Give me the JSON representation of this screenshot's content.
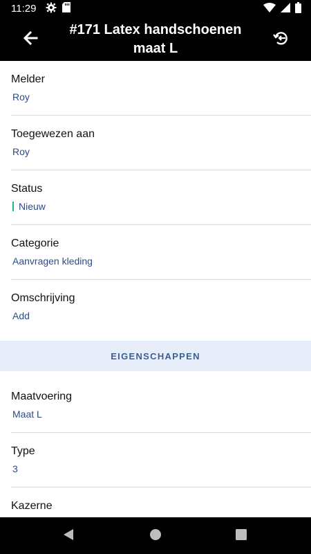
{
  "status_bar": {
    "time": "11:29",
    "left_icons": [
      "gear-icon",
      "sd-card-icon"
    ],
    "right_icons": [
      "wifi-icon",
      "signal-icon",
      "battery-icon"
    ]
  },
  "app_bar": {
    "title": "#171 Latex handschoenen maat L",
    "back_icon": "arrow-left-icon",
    "history_icon": "history-icon"
  },
  "fields": [
    {
      "label": "Melder",
      "value": "Roy"
    },
    {
      "label": "Toegewezen aan",
      "value": "Roy"
    },
    {
      "label": "Status",
      "value": "Nieuw",
      "status_color": "#18b78a"
    },
    {
      "label": "Categorie",
      "value": "Aanvragen kleding"
    },
    {
      "label": "Omschrijving",
      "value": "Add"
    }
  ],
  "section": {
    "title": "EIGENSCHAPPEN"
  },
  "properties": [
    {
      "label": "Maatvoering",
      "value": "Maat L"
    },
    {
      "label": "Type",
      "value": "3"
    },
    {
      "label": "Kazerne",
      "value": ""
    }
  ],
  "colors": {
    "value_text": "#2b4b8a",
    "section_bg": "#e7eef9",
    "section_text": "#3f5f8f"
  },
  "nav": [
    "back-triangle-icon",
    "home-circle-icon",
    "recents-square-icon"
  ]
}
